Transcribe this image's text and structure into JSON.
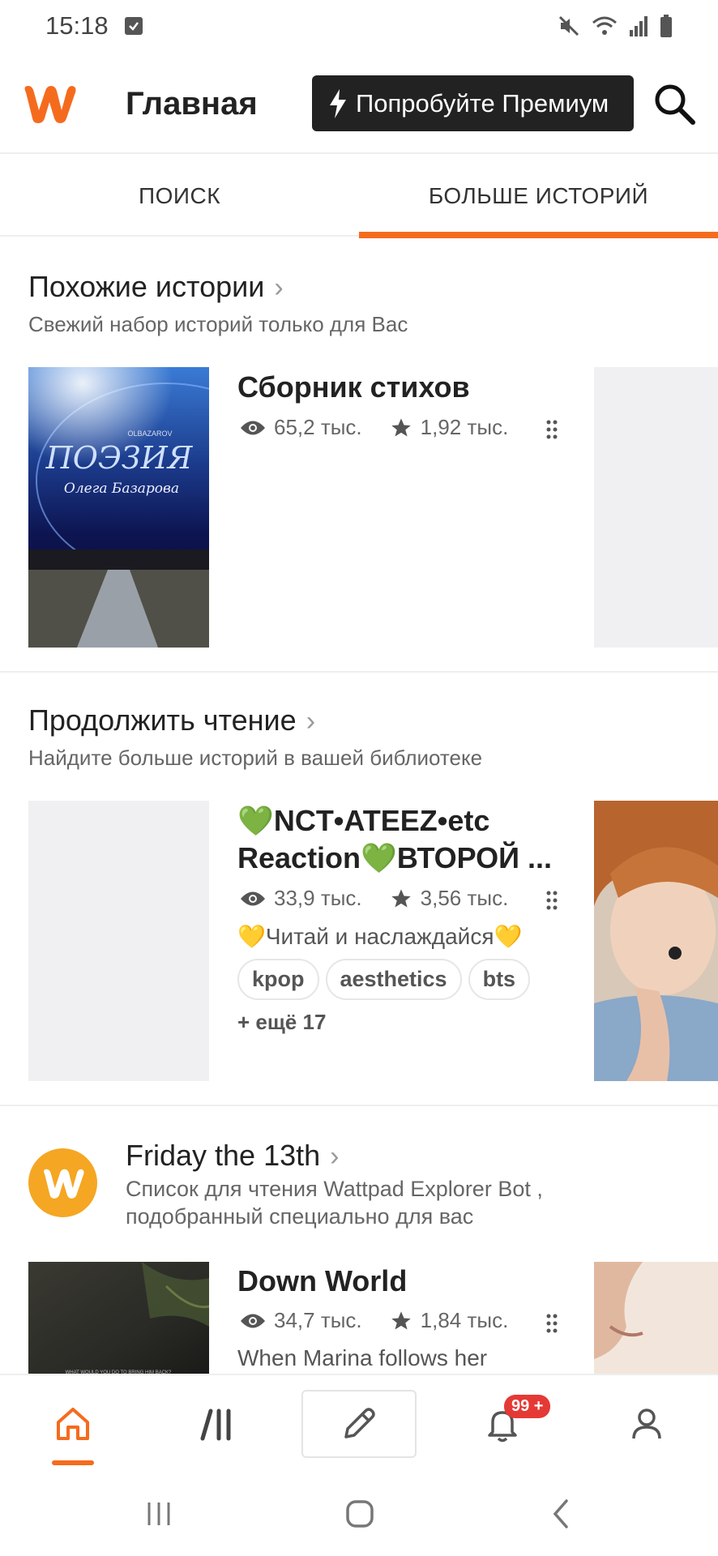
{
  "status_bar": {
    "time": "15:18"
  },
  "header": {
    "title": "Главная",
    "premium_label": "Попробуйте Премиум"
  },
  "tabs": [
    {
      "label": "ПОИСК",
      "active": false
    },
    {
      "label": "БОЛЬШЕ ИСТОРИЙ",
      "active": true
    }
  ],
  "sections": [
    {
      "title": "Похожие истории",
      "subtitle": "Свежий набор историй только для Вас",
      "story": {
        "title": "Сборник стихов",
        "views": "65,2 тыс.",
        "votes": "1,92 тыс.",
        "cover_text": {
          "author_latin": "OLBAZAROV",
          "title": "ПОЭЗИЯ",
          "author": "Олега Базарова"
        }
      }
    },
    {
      "title": "Продолжить чтение",
      "subtitle": "Найдите больше историй в вашей библиотеке",
      "story": {
        "title_line1": "💚NCT•ATEEZ•etc",
        "title_line2": "Reaction💚ВТОРОЙ ...",
        "views": "33,9 тыс.",
        "votes": "3,56 тыс.",
        "description": "💛Читай и наслаждайся💛",
        "tags": [
          "kpop",
          "aesthetics",
          "bts"
        ],
        "more_tags": "+ ещё 17"
      }
    },
    {
      "title": "Friday the 13th",
      "subtitle": "Список для чтения Wattpad Explorer Bot , подобранный специально для вас",
      "story": {
        "title": "Down World",
        "views": "34,7 тыс.",
        "votes": "1,84 тыс.",
        "description": "When Marina follows her",
        "cover_text": "WHAT WOULD YOU DO TO BRING HIM BACK?"
      }
    }
  ],
  "bottom_nav": {
    "notification_badge": "99 +"
  },
  "colors": {
    "accent": "#f56b1e",
    "premium_bg": "#222222",
    "badge": "#e53935"
  }
}
